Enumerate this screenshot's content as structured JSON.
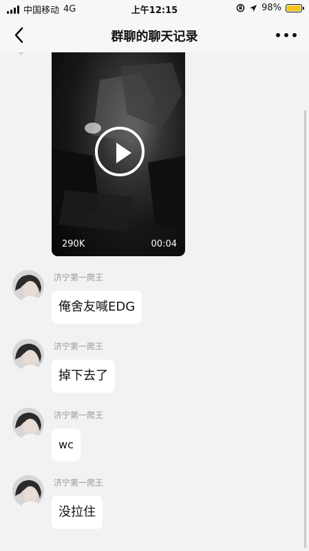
{
  "status_bar": {
    "carrier": "中国移动",
    "network": "4G",
    "time": "上午12:15",
    "battery_percent": "98%",
    "battery_level": 0.98,
    "icons": [
      "signal-icon",
      "lock-rotation-icon",
      "location-icon",
      "battery-charging-icon"
    ]
  },
  "header": {
    "title": "群聊的聊天记录",
    "back_icon": "chevron-left-icon",
    "more_icon": "more-horizontal-icon"
  },
  "video": {
    "size": "290K",
    "duration": "00:04"
  },
  "messages": [
    {
      "sender": "济宁第一爬王",
      "text": "俺舍友喊EDG"
    },
    {
      "sender": "济宁第一爬王",
      "text": "掉下去了"
    },
    {
      "sender": "济宁第一爬王",
      "text": "wc"
    },
    {
      "sender": "济宁第一爬王",
      "text": "没拉住"
    }
  ],
  "colors": {
    "background": "#f2f2f2",
    "bar": "#f7f7f7",
    "bubble": "#ffffff",
    "sender_name": "#999999",
    "battery_fill": "#f5c518"
  }
}
